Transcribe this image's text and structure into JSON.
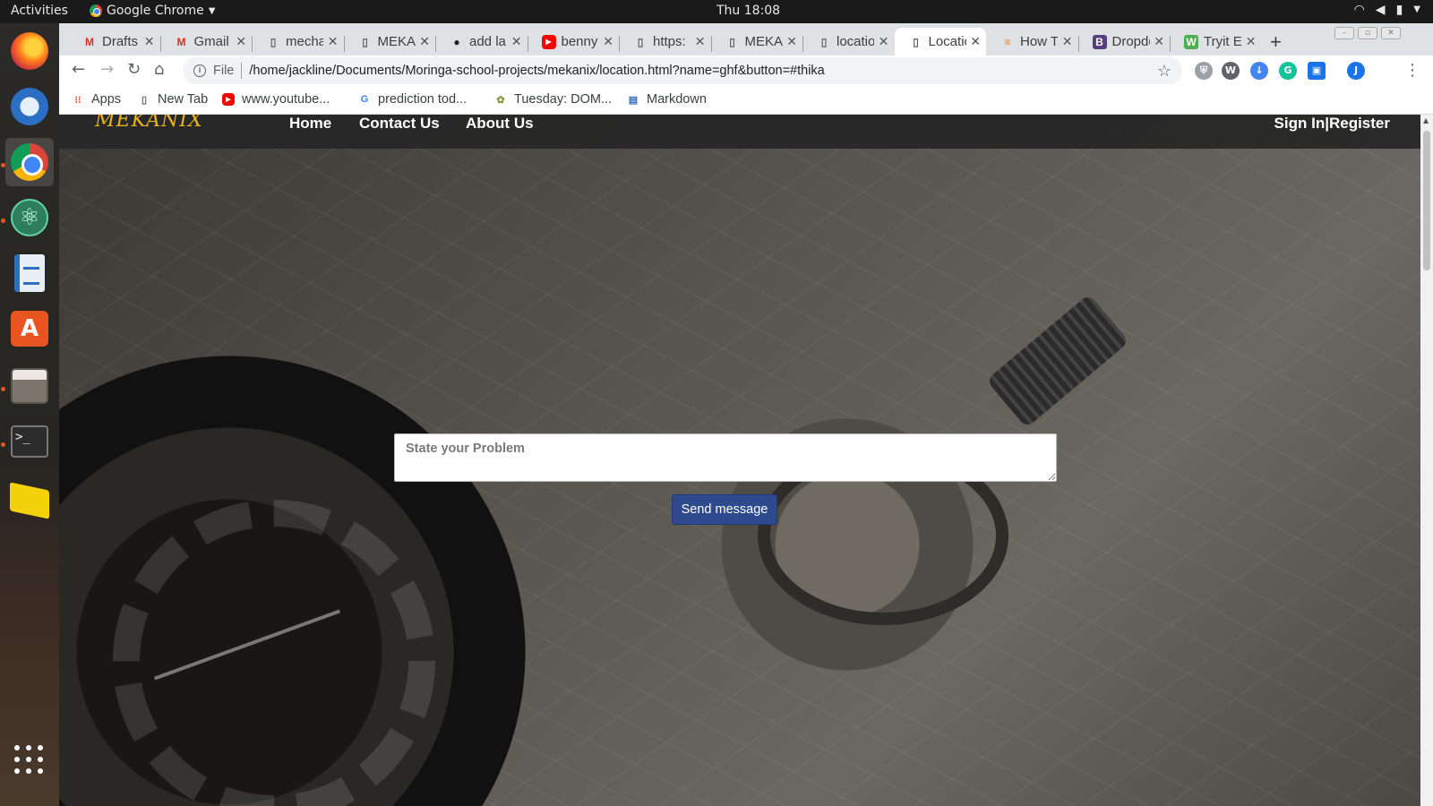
{
  "system": {
    "activities": "Activities",
    "app_name": "Google Chrome",
    "clock": "Thu 18:08"
  },
  "dock": {
    "items": [
      "Firefox",
      "Thunderbird",
      "Google Chrome",
      "Atom",
      "LibreOffice Writer",
      "Ubuntu Software",
      "Files",
      "Terminal",
      "Sticky Notes",
      "Show Applications"
    ]
  },
  "tabs": [
    {
      "title": "Drafts",
      "icon": "gmail-icon",
      "color": "#d93025"
    },
    {
      "title": "Gmail",
      "icon": "gmail-icon",
      "color": "#d93025"
    },
    {
      "title": "mechanic",
      "icon": "page-icon",
      "color": "#5f6368"
    },
    {
      "title": "MEKANIX",
      "icon": "page-icon",
      "color": "#5f6368"
    },
    {
      "title": "add la",
      "icon": "github-icon",
      "color": "#202124"
    },
    {
      "title": "benny",
      "icon": "youtube-icon",
      "color": "#ff0000"
    },
    {
      "title": "https:",
      "icon": "page-icon",
      "color": "#5f6368"
    },
    {
      "title": "MEKANIX",
      "icon": "page-icon",
      "color": "#5f6368"
    },
    {
      "title": "location",
      "icon": "page-icon",
      "color": "#5f6368"
    },
    {
      "title": "Location",
      "icon": "page-icon",
      "color": "#5f6368",
      "active": true
    },
    {
      "title": "How T",
      "icon": "stackoverflow-icon",
      "color": "#f48024"
    },
    {
      "title": "Dropdown",
      "icon": "bootstrap-icon",
      "color": "#563d7c"
    },
    {
      "title": "Tryit E",
      "icon": "w3schools-icon",
      "color": "#4caf50"
    }
  ],
  "toolbar": {
    "scheme": "File",
    "url": "/home/jackline/Documents/Moringa-school-projects/mekanix/location.html?name=ghf&button=#thika",
    "profile_initial": "J"
  },
  "bookmarks": [
    {
      "label": "Apps",
      "icon": "apps-grid-icon"
    },
    {
      "label": "New Tab",
      "icon": "page-icon"
    },
    {
      "label": "www.youtube...",
      "icon": "youtube-icon"
    },
    {
      "label": "prediction tod...",
      "icon": "google-icon"
    },
    {
      "label": "Tuesday: DOM...",
      "icon": "plant-icon"
    },
    {
      "label": "Markdown",
      "icon": "markdown-icon"
    }
  ],
  "page": {
    "brand": "MEKANIX",
    "nav": {
      "home": "Home",
      "contact": "Contact Us",
      "about": "About Us",
      "signin": "Sign In|Register"
    },
    "form": {
      "placeholder": "State your Problem",
      "send_label": "Send message"
    }
  },
  "colors": {
    "accent_button": "#2c4a8c",
    "brand_yellow": "#e7b21c",
    "navbar_bg": "#282828"
  }
}
